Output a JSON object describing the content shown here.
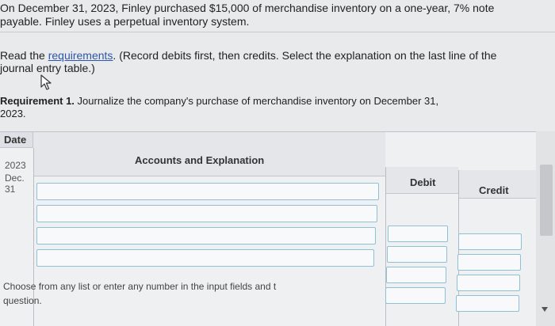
{
  "problem": {
    "line1": "On December 31, 2023, Finley purchased $15,000 of merchandise inventory on a one-year, 7% note",
    "line2": "payable. Finley uses a perpetual inventory system.",
    "instr_prefix": "Read the ",
    "instr_link": "requirements",
    "instr_suffix": ". (Record debits first, then credits. Select the explanation on the last line of the",
    "instr_line2": "journal entry table.)"
  },
  "requirement": {
    "label": "Requirement 1.",
    "text": " Journalize the company's purchase of merchandise inventory on December 31,",
    "year": "2023."
  },
  "journal": {
    "date_header": "Date",
    "accounts_header": "Accounts and Explanation",
    "debit_header": "Debit",
    "credit_header": "Credit",
    "date_year": "2023",
    "date_month": "Dec.",
    "date_day": "31"
  },
  "footer": {
    "line1": "Choose from any list or enter any number in the input fields and t",
    "line2": "question."
  },
  "icons": {
    "cursor": "pointer-cursor-icon",
    "scroll_down": "scroll-down-arrow-icon"
  }
}
